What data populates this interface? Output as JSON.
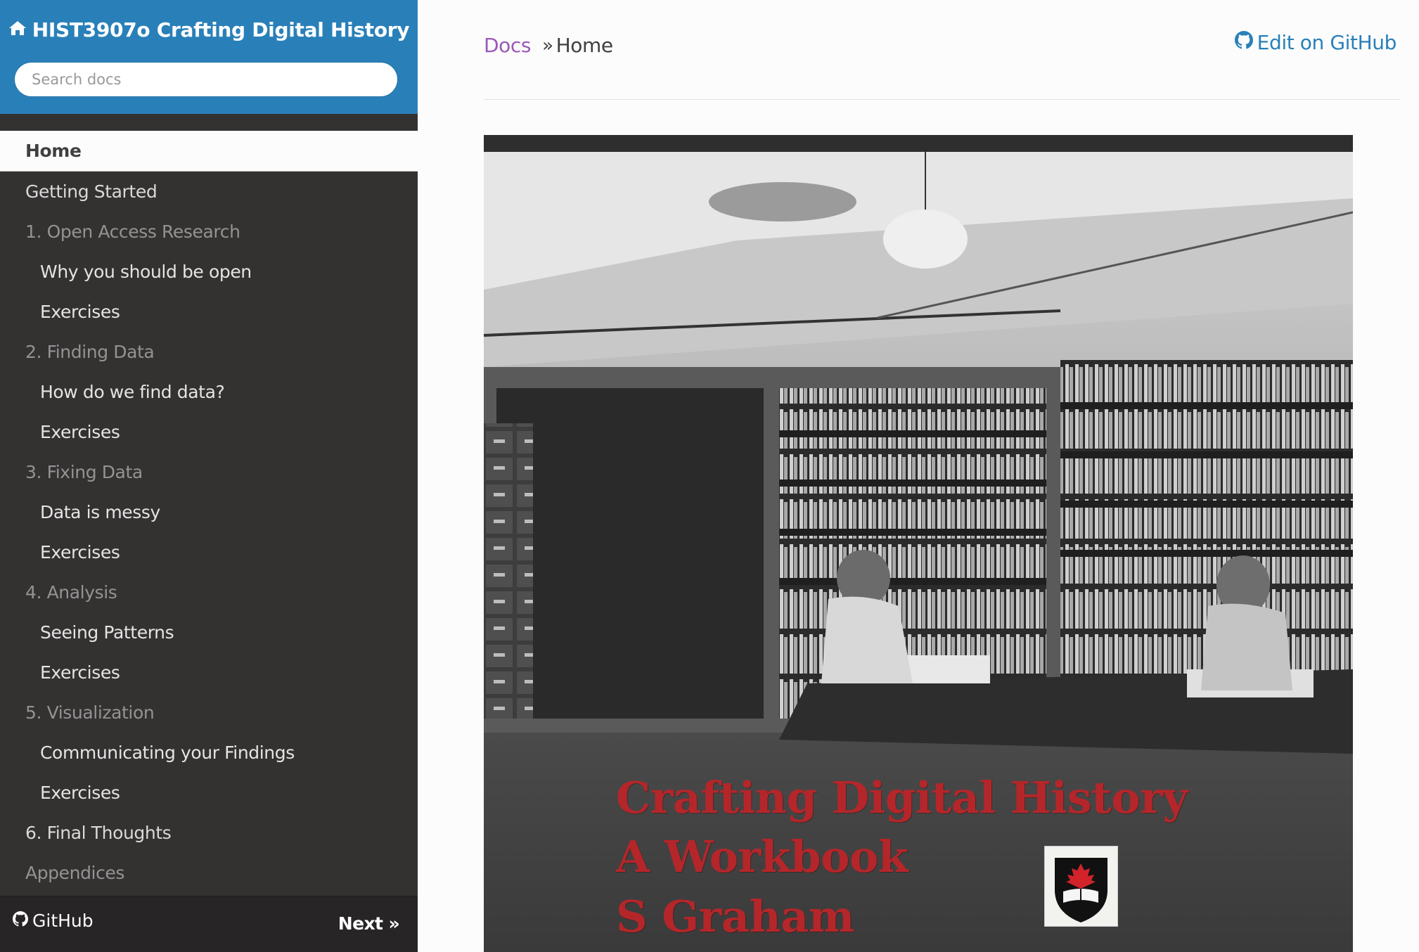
{
  "project": {
    "title": "HIST3907o Crafting Digital History",
    "icon": "home-icon"
  },
  "search": {
    "placeholder": "Search docs"
  },
  "nav": {
    "items": [
      {
        "label": "Home",
        "kind": "current"
      },
      {
        "label": "Getting Started",
        "kind": "top"
      },
      {
        "label": "1. Open Access Research",
        "kind": "caption"
      },
      {
        "label": "Why you should be open",
        "kind": "sub"
      },
      {
        "label": "Exercises",
        "kind": "sub"
      },
      {
        "label": "2. Finding Data",
        "kind": "caption"
      },
      {
        "label": "How do we find data?",
        "kind": "sub"
      },
      {
        "label": "Exercises",
        "kind": "sub"
      },
      {
        "label": "3. Fixing Data",
        "kind": "caption"
      },
      {
        "label": "Data is messy",
        "kind": "sub"
      },
      {
        "label": "Exercises",
        "kind": "sub"
      },
      {
        "label": "4. Analysis",
        "kind": "caption"
      },
      {
        "label": "Seeing Patterns",
        "kind": "sub"
      },
      {
        "label": "Exercises",
        "kind": "sub"
      },
      {
        "label": "5. Visualization",
        "kind": "caption"
      },
      {
        "label": "Communicating your Findings",
        "kind": "sub"
      },
      {
        "label": "Exercises",
        "kind": "sub"
      },
      {
        "label": "6. Final Thoughts",
        "kind": "top"
      },
      {
        "label": "Appendices",
        "kind": "caption"
      }
    ]
  },
  "footer": {
    "github_label": "GitHub",
    "next_label": "Next »"
  },
  "breadcrumbs": {
    "docs": "Docs",
    "separator": "»",
    "current": "Home"
  },
  "edit": {
    "label": "Edit on GitHub",
    "icon": "github-icon"
  },
  "cover": {
    "line1": "Crafting Digital History",
    "line2": "A Workbook",
    "line3": "S Graham"
  },
  "colors": {
    "sidebar_bg": "#343131",
    "header_bg": "#2980b9",
    "link_purple": "#9b59b6",
    "link_blue": "#2980b9",
    "cover_text": "#b4262a"
  }
}
